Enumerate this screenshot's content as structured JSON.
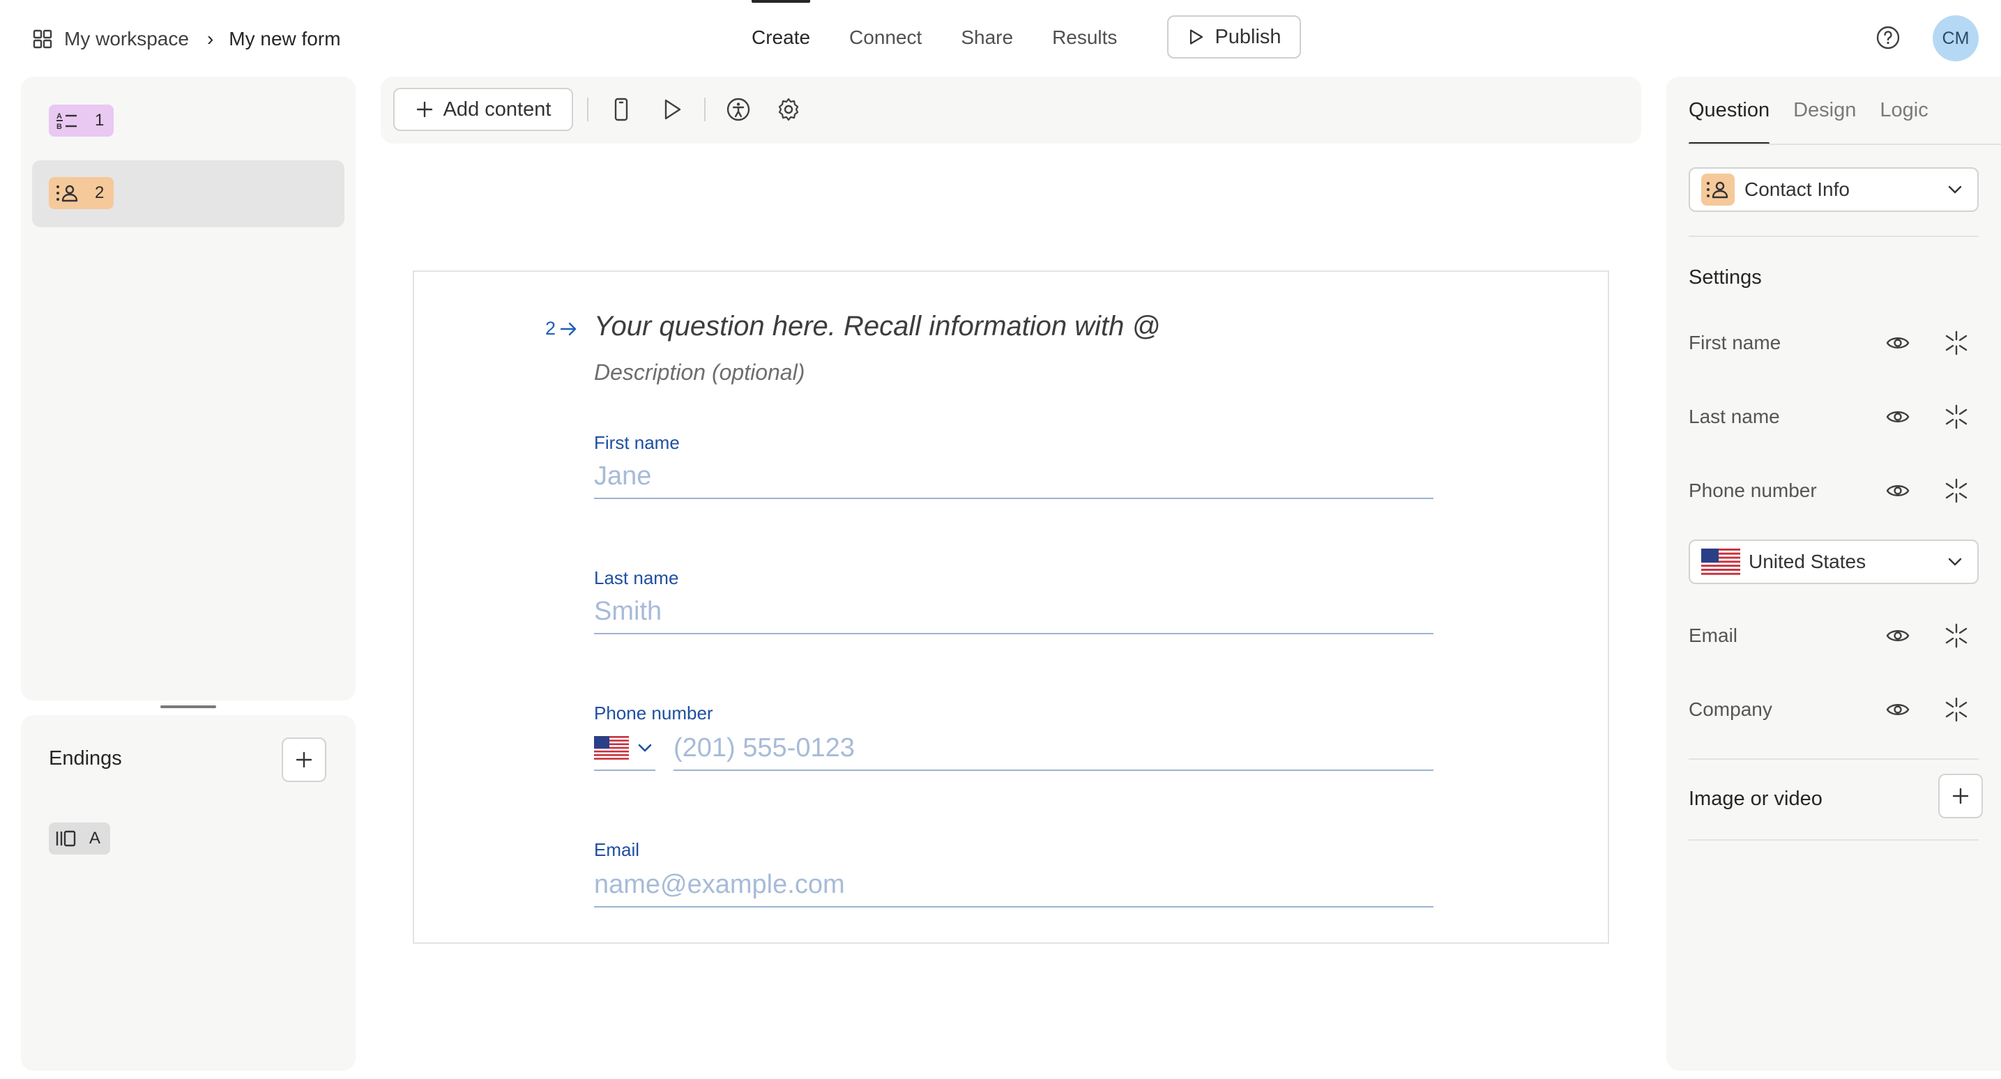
{
  "breadcrumb": {
    "workspace": "My workspace",
    "separator": "›",
    "form_name": "My new form"
  },
  "nav": {
    "create": "Create",
    "connect": "Connect",
    "share": "Share",
    "results": "Results",
    "publish": "Publish"
  },
  "user": {
    "initials": "CM",
    "avatar_color": "#b5d9f5"
  },
  "sidebar": {
    "questions": [
      {
        "number": "1",
        "icon": "multiple-choice-icon",
        "color": "#e9c8f2"
      },
      {
        "number": "2",
        "icon": "contact-info-icon",
        "color": "#f5c99a"
      }
    ],
    "endings_title": "Endings",
    "endings": [
      {
        "label": "A",
        "icon": "ending-screen-icon"
      }
    ]
  },
  "toolbar": {
    "add_content": "Add content"
  },
  "question": {
    "number": "2",
    "title_placeholder": "Your question here. Recall information with @",
    "description_placeholder": "Description (optional)",
    "fields": {
      "first_name": {
        "label": "First name",
        "placeholder": "Jane"
      },
      "last_name": {
        "label": "Last name",
        "placeholder": "Smith"
      },
      "phone": {
        "label": "Phone number",
        "placeholder": "(201) 555-0123"
      },
      "email": {
        "label": "Email",
        "placeholder": "name@example.com"
      }
    }
  },
  "panel": {
    "tabs": {
      "question": "Question",
      "design": "Design",
      "logic": "Logic"
    },
    "type_select": "Contact Info",
    "settings_title": "Settings",
    "settings_rows": {
      "first_name": "First name",
      "last_name": "Last name",
      "phone": "Phone number",
      "email": "Email",
      "company": "Company"
    },
    "country": "United States",
    "media_title": "Image or video"
  },
  "colors": {
    "accent_blue": "#1f5fb8",
    "field_label": "#1f4fa0",
    "placeholder": "#a7bbd8"
  }
}
